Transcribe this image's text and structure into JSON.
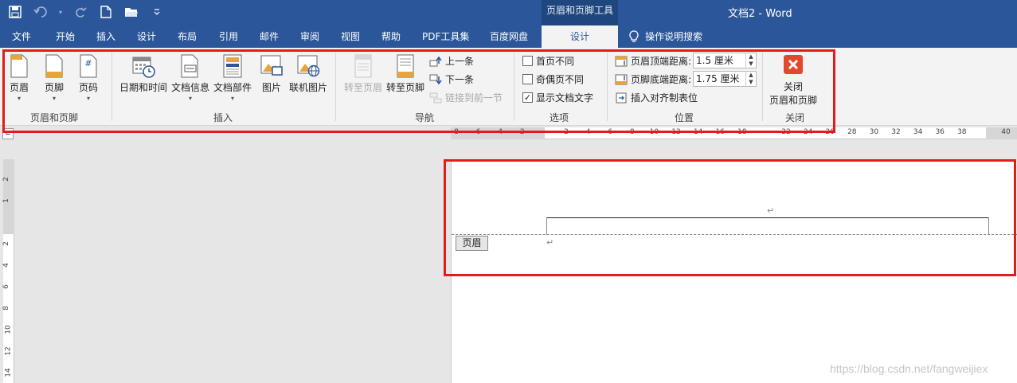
{
  "title_bar": {
    "context_tab": "页眉和页脚工具",
    "doc_title": "文档2  -  Word"
  },
  "tabs": [
    "文件",
    "开始",
    "插入",
    "设计",
    "布局",
    "引用",
    "邮件",
    "审阅",
    "视图",
    "帮助",
    "PDF工具集",
    "百度网盘",
    "设计"
  ],
  "tell_me": "操作说明搜索",
  "ribbon": {
    "groups": {
      "header_footer": {
        "label": "页眉和页脚",
        "header": "页眉",
        "footer": "页脚",
        "page_number": "页码"
      },
      "insert": {
        "label": "插入",
        "date_time": "日期和时间",
        "doc_info": "文档信息",
        "doc_parts": "文档部件",
        "picture": "图片",
        "online_picture": "联机图片"
      },
      "navigation": {
        "label": "导航",
        "goto_header": "转至页眉",
        "goto_footer": "转至页脚",
        "previous": "上一条",
        "next": "下一条",
        "link_previous": "链接到前一节"
      },
      "options": {
        "label": "选项",
        "first_page": "首页不同",
        "odd_even": "奇偶页不同",
        "show_text": "显示文档文字",
        "first_page_checked": false,
        "odd_even_checked": false,
        "show_text_checked": true
      },
      "position": {
        "label": "位置",
        "header_top": "页眉顶端距离:",
        "header_top_value": "1.5 厘米",
        "footer_bottom": "页脚底端距离:",
        "footer_bottom_value": "1.75 厘米",
        "insert_tab": "插入对齐制表位"
      },
      "close": {
        "label": "关闭",
        "close_button_line1": "关闭",
        "close_button_line2": "页眉和页脚"
      }
    }
  },
  "ruler": {
    "h_labels": [
      "8",
      "6",
      "4",
      "2",
      "",
      "2",
      "4",
      "6",
      "8",
      "10",
      "12",
      "14",
      "16",
      "18",
      "",
      "22",
      "24",
      "26",
      "28",
      "30",
      "32",
      "34",
      "36",
      "38",
      "",
      "40"
    ],
    "v_labels": [
      "2",
      "1",
      "",
      "2",
      "4",
      "6",
      "8",
      "10",
      "12",
      "14"
    ]
  },
  "document": {
    "header_tag": "页眉",
    "para_mark": "↵"
  },
  "watermark": "https://blog.csdn.net/fangweijiex",
  "colors": {
    "title_bar": "#2b579a",
    "highlight": "#e01c1c",
    "close_icon": "#e04a2a"
  }
}
